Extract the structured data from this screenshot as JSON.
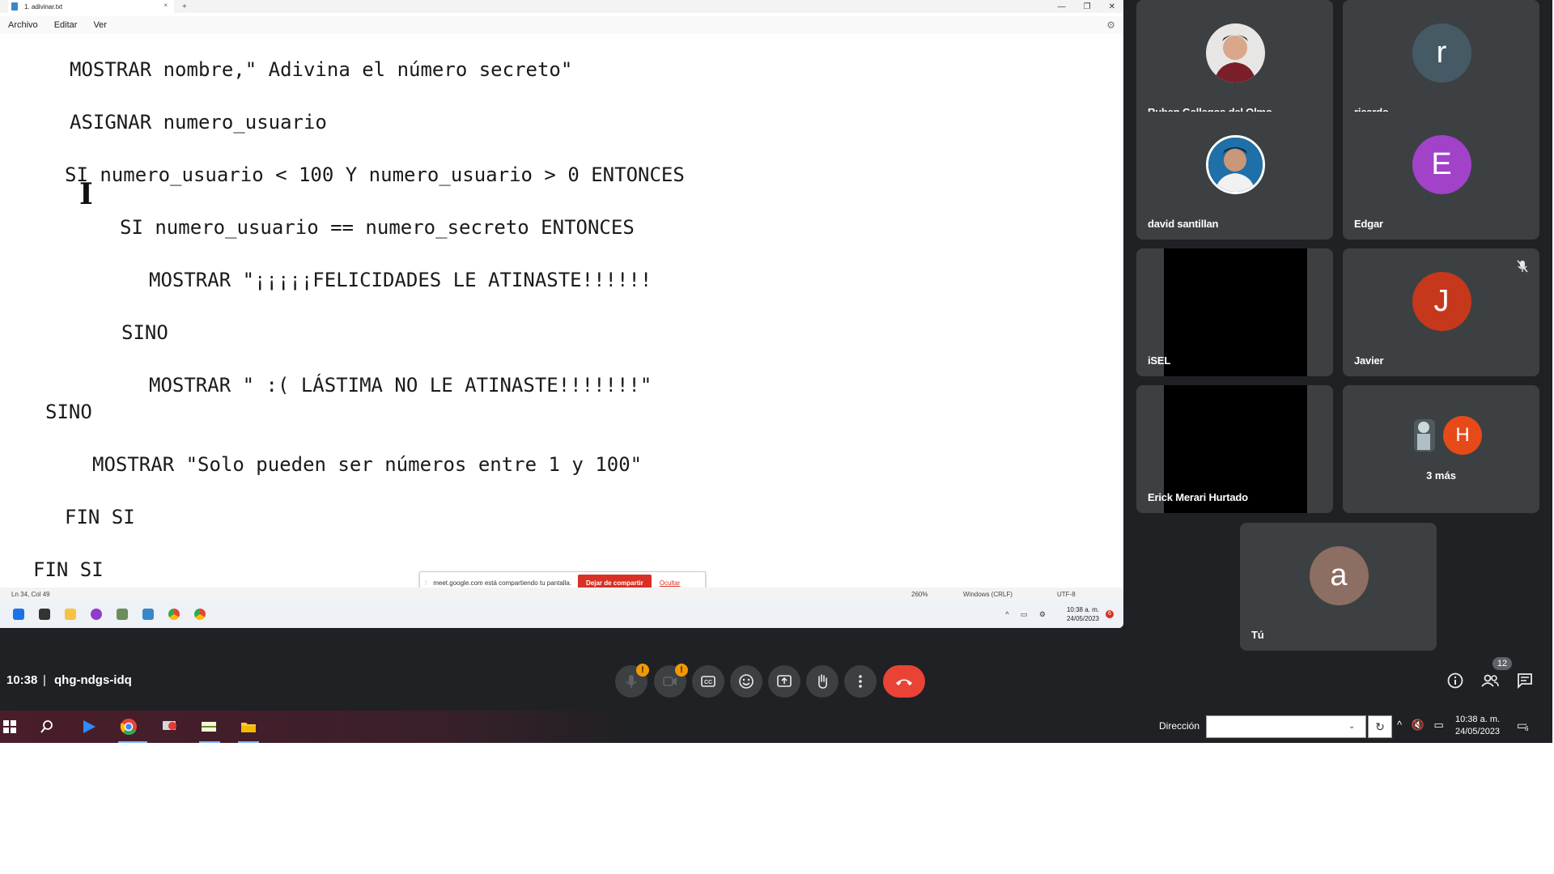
{
  "notepad": {
    "tab_title": "1. adivinar.txt",
    "tab_close": "×",
    "new_tab": "+",
    "window_controls": [
      "—",
      "❐",
      "✕"
    ],
    "menu": [
      "Archivo",
      "Editar",
      "Ver"
    ],
    "code_lines": [
      "MOSTRAR nombre,\" Adivina el número secreto\"",
      "ASIGNAR numero_usuario",
      "SI numero_usuario < 100 Y numero_usuario > 0 ENTONCES",
      "SI numero_usuario == numero_secreto ENTONCES",
      "MOSTRAR \"¡¡¡¡¡FELICIDADES LE ATINASTE!!!!!!",
      "SINO",
      "MOSTRAR \" :( LÁSTIMA NO LE ATINASTE!!!!!!!\"",
      "SINO",
      "MOSTRAR \"Solo pueden ser números entre 1 y 100\"",
      "FIN SI",
      "FIN SI"
    ],
    "status": {
      "position": "Ln 34, Col 49",
      "zoom": "260%",
      "line_ending": "Windows (CRLF)",
      "encoding": "UTF-8"
    },
    "inner_clock": {
      "time": "10:38 a. m.",
      "date": "24/05/2023"
    },
    "inner_notifications": "6"
  },
  "share_banner": {
    "message": "meet.google.com está compartiendo tu pantalla.",
    "stop_label": "Dejar de compartir",
    "hide_label": "Ocultar"
  },
  "participants": [
    {
      "name": "Ruben Gallegos del Olmo",
      "kind": "photo"
    },
    {
      "name": "ricardo",
      "kind": "letter",
      "letter": "r",
      "color": "#455a64"
    },
    {
      "name": "david santillan",
      "kind": "photo"
    },
    {
      "name": "Edgar",
      "kind": "letter",
      "letter": "E",
      "color": "#a142c9"
    },
    {
      "name": "iSEL",
      "kind": "video"
    },
    {
      "name": "Javier",
      "kind": "letter",
      "letter": "J",
      "color": "#c5381c",
      "muted": true
    },
    {
      "name": "Erick Merari Hurtado",
      "kind": "video"
    },
    {
      "name": "3 más",
      "kind": "more",
      "letter": "H",
      "color": "#e64a19"
    },
    {
      "name": "Tú",
      "kind": "letter",
      "letter": "a",
      "color": "#8d6e63"
    }
  ],
  "meeting": {
    "time": "10:38",
    "separator": "|",
    "code": "qhg-ndgs-idq",
    "people_count": "12",
    "warning_mark": "!"
  },
  "taskbar": {
    "address_label": "Dirección",
    "address_value": "",
    "clock_time": "10:38 a. m.",
    "clock_date": "24/05/2023",
    "notifications": "6"
  }
}
